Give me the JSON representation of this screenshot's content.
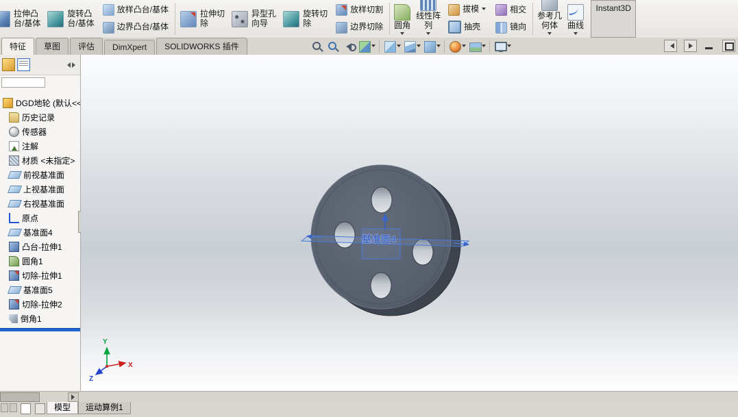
{
  "colors": {
    "plane_blue": "#4a7ad6",
    "rollback_bar": "#1e66d0",
    "axis_x": "#cc2222",
    "axis_y": "#00a33c",
    "axis_z": "#2244cc",
    "model_gray": "#565e6b"
  },
  "ribbon": {
    "cells": [
      {
        "label": "拉伸凸\n台/基体"
      },
      {
        "label": "旋转凸\n台/基体"
      },
      {
        "label": "放样凸台/基体"
      },
      {
        "label": "边界凸台/基体"
      },
      {
        "label": "拉伸切\n除"
      },
      {
        "label": "异型孔\n向导"
      },
      {
        "label": "旋转切\n除"
      },
      {
        "label": "放样切割"
      },
      {
        "label": "边界切除"
      },
      {
        "label": "圆角"
      },
      {
        "label": "线性阵\n列"
      },
      {
        "label": "拔模"
      },
      {
        "label": "抽壳"
      },
      {
        "label": "相交"
      },
      {
        "label": "镜向"
      },
      {
        "label": "参考几\n何体"
      },
      {
        "label": "曲线"
      },
      {
        "label": "Instant3D"
      }
    ]
  },
  "tabs": {
    "items": [
      {
        "label": "特征"
      },
      {
        "label": "草图"
      },
      {
        "label": "评估"
      },
      {
        "label": "DimXpert"
      },
      {
        "label": "SOLIDWORKS 插件"
      }
    ],
    "active": "特征"
  },
  "tree": {
    "items": [
      {
        "label": "DGD地轮 (默认<<"
      },
      {
        "label": "历史记录"
      },
      {
        "label": "传感器"
      },
      {
        "label": "注解"
      },
      {
        "label": "材质 <未指定>"
      },
      {
        "label": "前视基准面"
      },
      {
        "label": "上视基准面"
      },
      {
        "label": "右视基准面"
      },
      {
        "label": "原点"
      },
      {
        "label": "基准面4"
      },
      {
        "label": "凸台-拉伸1"
      },
      {
        "label": "圆角1"
      },
      {
        "label": "切除-拉伸1"
      },
      {
        "label": "基准面5"
      },
      {
        "label": "切除-拉伸2"
      },
      {
        "label": "倒角1"
      }
    ]
  },
  "viewport": {
    "plane_label": "基准面4",
    "axis_x": "X",
    "axis_y": "Y",
    "axis_z": "Z"
  },
  "bottom": {
    "tabs": [
      {
        "label": "模型"
      },
      {
        "label": "运动算例1"
      }
    ],
    "active": "模型"
  }
}
